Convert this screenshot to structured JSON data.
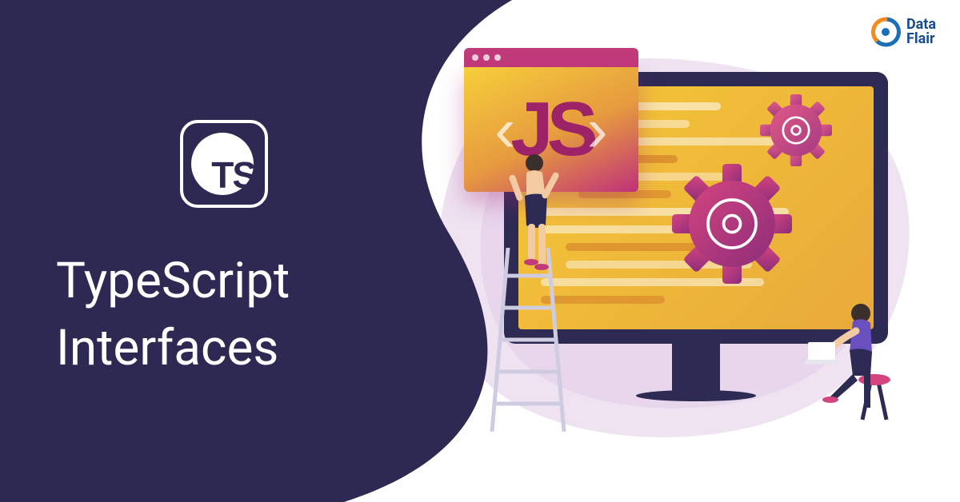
{
  "brand": {
    "name_line1": "Data",
    "name_line2": "Flair"
  },
  "hero": {
    "logo_text": "TS",
    "title_line1": "TypeScript",
    "title_line2": "Interfaces"
  },
  "illustration": {
    "js_window_label": "JS",
    "angle_left": "‹",
    "angle_right": "›"
  },
  "colors": {
    "panel_bg": "#2e2952",
    "accent_pink": "#c13a7a",
    "accent_yellow": "#f5c838",
    "brand_blue": "#1a4d8f"
  }
}
